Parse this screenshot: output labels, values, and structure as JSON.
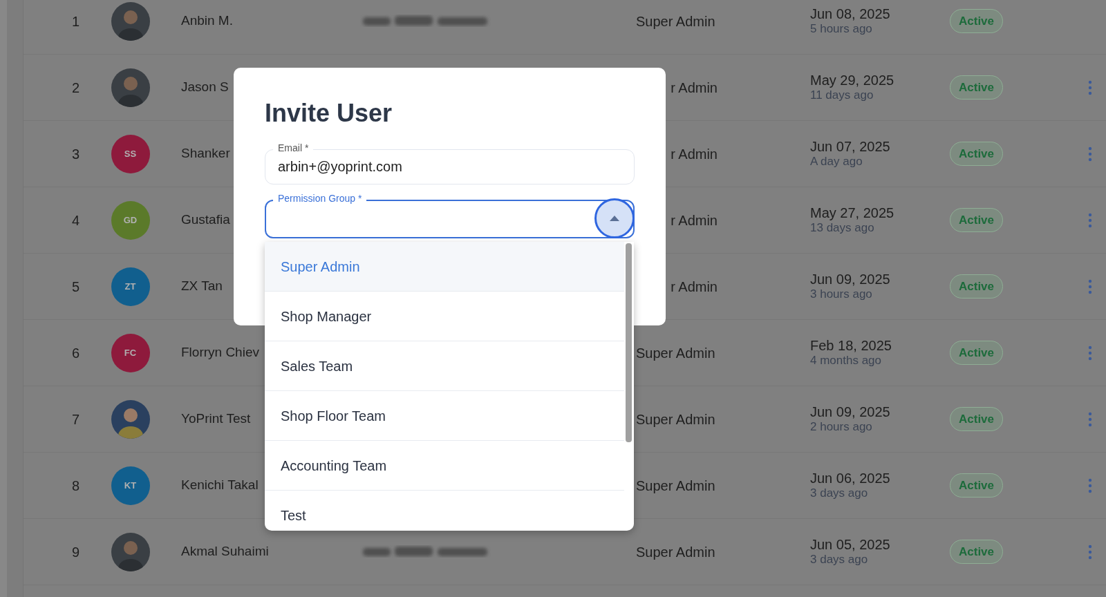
{
  "users": [
    {
      "number": "1",
      "name": "Anbin M.",
      "redacted": true,
      "role": "Super Admin",
      "date": "Jun 08, 2025",
      "ago": "5 hours ago",
      "status": "Active",
      "menu": false
    },
    {
      "number": "2",
      "name": "Jason S",
      "redacted": false,
      "role": "r Admin",
      "date": "May 29, 2025",
      "ago": "11 days ago",
      "status": "Active",
      "menu": true
    },
    {
      "number": "3",
      "avatar": {
        "kind": "initials",
        "initials": "SS",
        "color": "#8e1a3c"
      },
      "name": "Shanker",
      "redacted": false,
      "role": "r Admin",
      "date": "Jun 07, 2025",
      "ago": "A day ago",
      "status": "Active",
      "menu": true
    },
    {
      "number": "4",
      "avatar": {
        "kind": "initials",
        "initials": "GD",
        "color": "#5b7a2a"
      },
      "name": "Gustafia",
      "redacted": false,
      "role": "r Admin",
      "date": "May 27, 2025",
      "ago": "13 days ago",
      "status": "Active",
      "menu": true
    },
    {
      "number": "5",
      "avatar": {
        "kind": "initials",
        "initials": "ZT",
        "color": "#115f8e"
      },
      "name": "ZX Tan",
      "redacted": false,
      "role": "r Admin",
      "date": "Jun 09, 2025",
      "ago": "3 hours ago",
      "status": "Active",
      "menu": true
    },
    {
      "number": "6",
      "avatar": {
        "kind": "initials",
        "initials": "FC",
        "color": "#8e1a3c"
      },
      "name": "Florryn Chiev",
      "redacted": false,
      "role": "Super Admin",
      "date": "Feb 18, 2025",
      "ago": "4 months ago",
      "status": "Active",
      "menu": true
    },
    {
      "number": "7",
      "avatar": {
        "kind": "silhouette"
      },
      "name": "YoPrint Test",
      "redacted": false,
      "role": "Super Admin",
      "date": "Jun 09, 2025",
      "ago": "2 hours ago",
      "status": "Active",
      "menu": true
    },
    {
      "number": "8",
      "avatar": {
        "kind": "initials",
        "initials": "KT",
        "color": "#115f8e"
      },
      "name": "Kenichi Takal",
      "redacted": false,
      "role": "Super Admin",
      "date": "Jun 06, 2025",
      "ago": "3 days ago",
      "status": "Active",
      "menu": true
    },
    {
      "number": "9",
      "name": "Akmal Suhaimi",
      "redacted": true,
      "role": "Super Admin",
      "date": "Jun 05, 2025",
      "ago": "3 days ago",
      "status": "Active",
      "menu": true
    }
  ],
  "modal": {
    "title": "Invite User",
    "email": {
      "label": "Email *",
      "value": "arbin+@yoprint.com"
    },
    "permission_group": {
      "label": "Permission Group *",
      "expanded": true,
      "options": [
        {
          "label": "Super Admin",
          "selected": true
        },
        {
          "label": "Shop Manager",
          "selected": false
        },
        {
          "label": "Sales Team",
          "selected": false
        },
        {
          "label": "Shop Floor Team",
          "selected": false
        },
        {
          "label": "Accounting Team",
          "selected": false
        },
        {
          "label": "Test",
          "selected": false
        }
      ]
    }
  }
}
